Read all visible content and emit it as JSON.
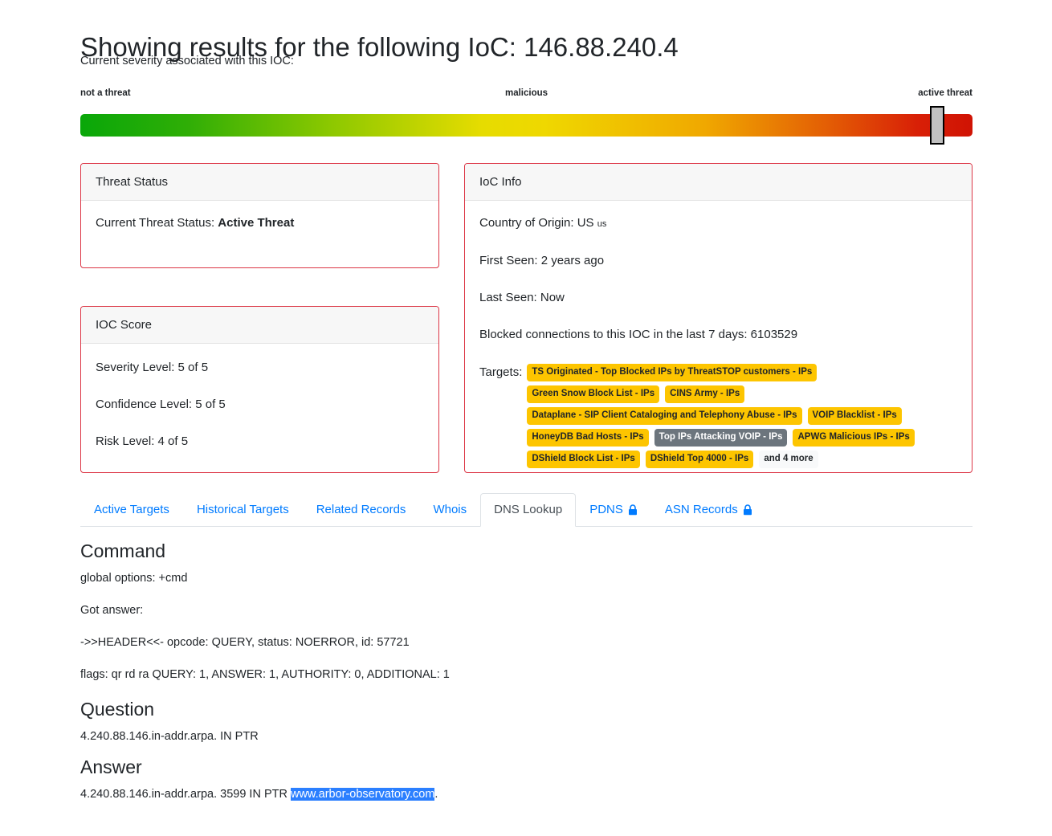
{
  "header": {
    "title": "Showing results for the following IoC: 146.88.240.4",
    "subtitle": "Current severity associated with this IOC:"
  },
  "severity": {
    "label_left": "not a threat",
    "label_mid": "malicious",
    "label_right": "active threat",
    "handle_position_pct": 96,
    "gradient_start_color": "#09a709",
    "gradient_mid_color": "#efd800",
    "gradient_end_color": "#d01304",
    "handle_color": "#c0c0c0"
  },
  "threat_status_card": {
    "header": "Threat Status",
    "label": "Current Threat Status:",
    "value": "Active Threat"
  },
  "ioc_score_card": {
    "header": "IOC Score",
    "severity_level": "Severity Level: 5 of 5",
    "confidence_level": "Confidence Level: 5 of 5",
    "risk_level": "Risk Level: 4 of 5"
  },
  "ioc_info_card": {
    "header": "IoC Info",
    "country_label": "Country of Origin: US",
    "country_flag_code": "us",
    "first_seen": "First Seen: 2 years ago",
    "last_seen": "Last Seen: Now",
    "blocked": "Blocked connections to this IOC in the last 7 days: 6103529",
    "targets_label": "Targets:",
    "targets": [
      {
        "label": "TS Originated - Top Blocked IPs by ThreatSTOP customers - IPs",
        "style": "warning"
      },
      {
        "label": "Green Snow Block List - IPs",
        "style": "warning"
      },
      {
        "label": "CINS Army - IPs",
        "style": "warning"
      },
      {
        "label": "Dataplane - SIP Client Cataloging and Telephony Abuse - IPs",
        "style": "warning"
      },
      {
        "label": "VOIP Blacklist - IPs",
        "style": "warning"
      },
      {
        "label": "HoneyDB Bad Hosts - IPs",
        "style": "warning"
      },
      {
        "label": "Top IPs Attacking VOIP - IPs",
        "style": "secondary"
      },
      {
        "label": "APWG Malicious IPs - IPs",
        "style": "warning"
      },
      {
        "label": "DShield Block List - IPs",
        "style": "warning"
      },
      {
        "label": "DShield Top 4000 - IPs",
        "style": "warning"
      },
      {
        "label": "and 4 more",
        "style": "light"
      }
    ]
  },
  "tabs": [
    {
      "label": "Active Targets",
      "active": false,
      "lock": false
    },
    {
      "label": "Historical Targets",
      "active": false,
      "lock": false
    },
    {
      "label": "Related Records",
      "active": false,
      "lock": false
    },
    {
      "label": "Whois",
      "active": false,
      "lock": false
    },
    {
      "label": "DNS Lookup",
      "active": true,
      "lock": false
    },
    {
      "label": "PDNS",
      "active": false,
      "lock": true
    },
    {
      "label": "ASN Records",
      "active": false,
      "lock": true
    }
  ],
  "command_section": {
    "heading": "Command",
    "line1": "global options: +cmd",
    "line2": "Got answer:",
    "line3": "->>HEADER<<- opcode: QUERY, status: NOERROR, id: 57721",
    "line4": "flags: qr rd ra QUERY: 1, ANSWER: 1, AUTHORITY: 0, ADDITIONAL: 1"
  },
  "question_section": {
    "heading": "Question",
    "line1": "4.240.88.146.in-addr.arpa. IN PTR"
  },
  "answer_section": {
    "heading": "Answer",
    "prefix": "4.240.88.146.in-addr.arpa. 3599 IN PTR ",
    "highlighted": "www.arbor-observatory.com",
    "suffix": "."
  }
}
